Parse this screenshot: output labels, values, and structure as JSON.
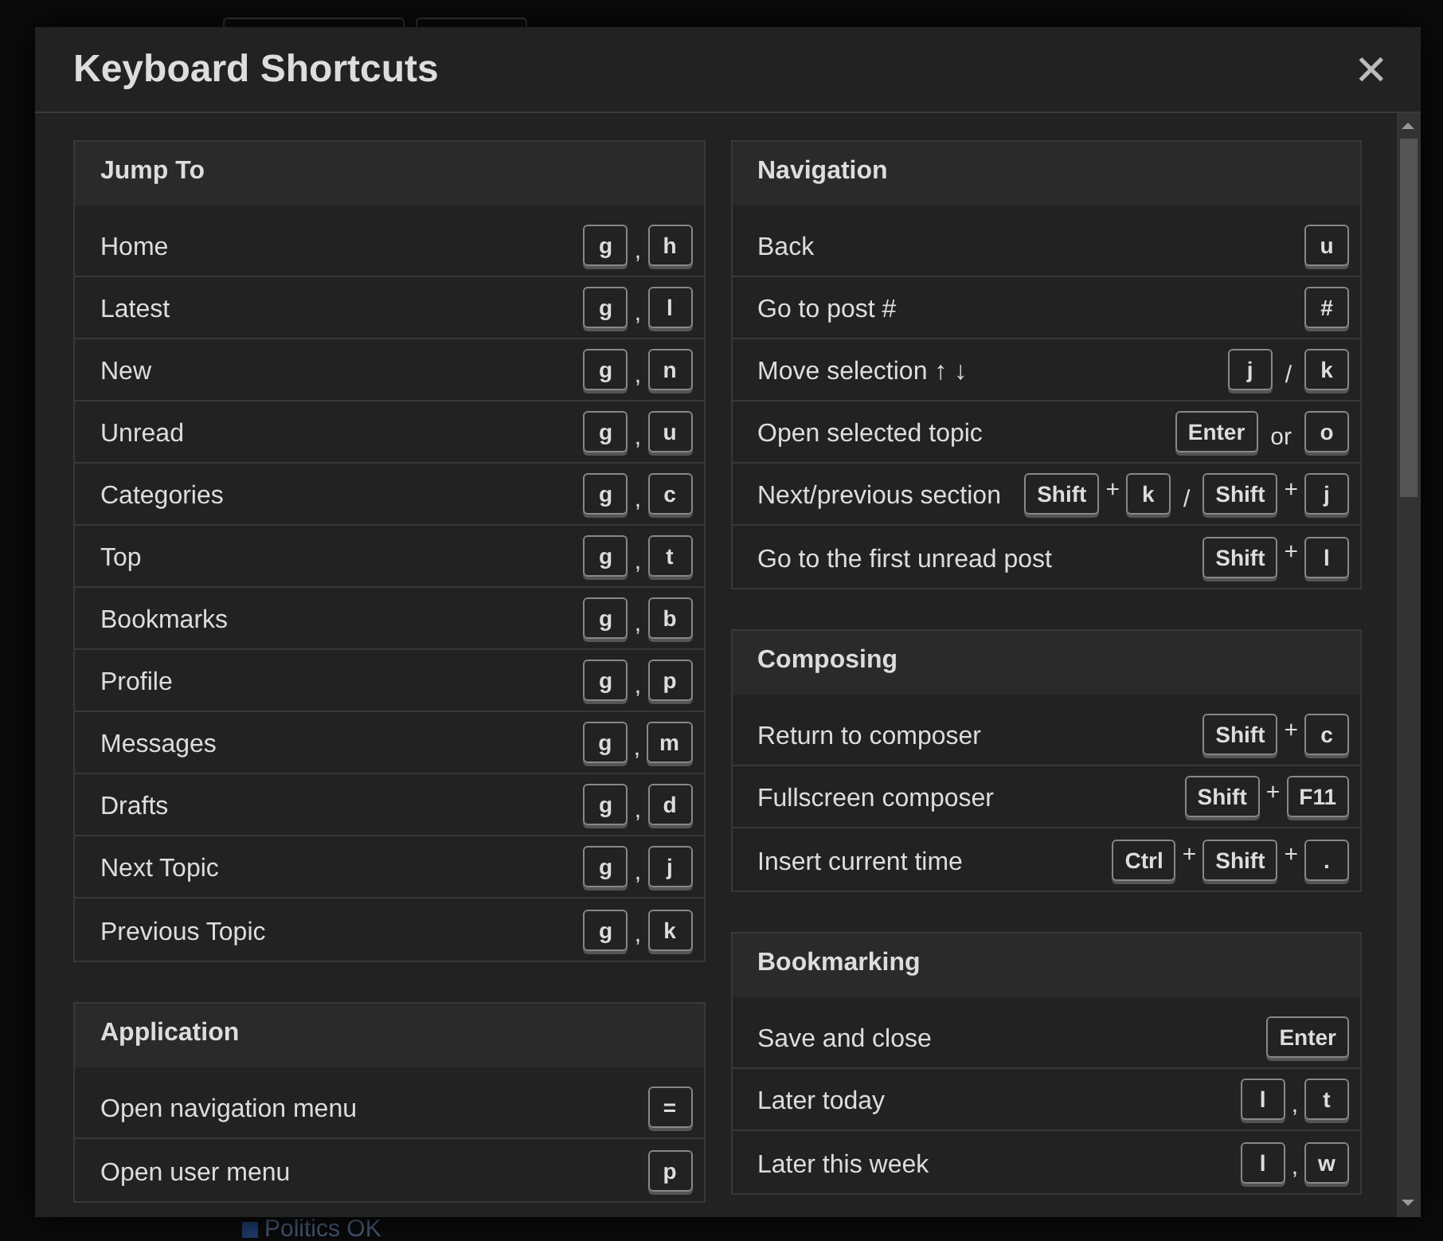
{
  "background": {
    "footer_text": "Politics OK"
  },
  "dialog": {
    "title": "Keyboard Shortcuts",
    "close_symbol": "✕",
    "columns": [
      [
        {
          "title": "Jump To",
          "shortcuts": [
            {
              "label": "Home",
              "keys": [
                {
                  "kind": "key",
                  "text": "g"
                },
                {
                  "kind": "sep",
                  "text": ","
                },
                {
                  "kind": "key",
                  "text": "h"
                }
              ]
            },
            {
              "label": "Latest",
              "keys": [
                {
                  "kind": "key",
                  "text": "g"
                },
                {
                  "kind": "sep",
                  "text": ","
                },
                {
                  "kind": "key",
                  "text": "l"
                }
              ]
            },
            {
              "label": "New",
              "keys": [
                {
                  "kind": "key",
                  "text": "g"
                },
                {
                  "kind": "sep",
                  "text": ","
                },
                {
                  "kind": "key",
                  "text": "n"
                }
              ]
            },
            {
              "label": "Unread",
              "keys": [
                {
                  "kind": "key",
                  "text": "g"
                },
                {
                  "kind": "sep",
                  "text": ","
                },
                {
                  "kind": "key",
                  "text": "u"
                }
              ]
            },
            {
              "label": "Categories",
              "keys": [
                {
                  "kind": "key",
                  "text": "g"
                },
                {
                  "kind": "sep",
                  "text": ","
                },
                {
                  "kind": "key",
                  "text": "c"
                }
              ]
            },
            {
              "label": "Top",
              "keys": [
                {
                  "kind": "key",
                  "text": "g"
                },
                {
                  "kind": "sep",
                  "text": ","
                },
                {
                  "kind": "key",
                  "text": "t"
                }
              ]
            },
            {
              "label": "Bookmarks",
              "keys": [
                {
                  "kind": "key",
                  "text": "g"
                },
                {
                  "kind": "sep",
                  "text": ","
                },
                {
                  "kind": "key",
                  "text": "b"
                }
              ]
            },
            {
              "label": "Profile",
              "keys": [
                {
                  "kind": "key",
                  "text": "g"
                },
                {
                  "kind": "sep",
                  "text": ","
                },
                {
                  "kind": "key",
                  "text": "p"
                }
              ]
            },
            {
              "label": "Messages",
              "keys": [
                {
                  "kind": "key",
                  "text": "g"
                },
                {
                  "kind": "sep",
                  "text": ","
                },
                {
                  "kind": "key",
                  "text": "m"
                }
              ]
            },
            {
              "label": "Drafts",
              "keys": [
                {
                  "kind": "key",
                  "text": "g"
                },
                {
                  "kind": "sep",
                  "text": ","
                },
                {
                  "kind": "key",
                  "text": "d"
                }
              ]
            },
            {
              "label": "Next Topic",
              "keys": [
                {
                  "kind": "key",
                  "text": "g"
                },
                {
                  "kind": "sep",
                  "text": ","
                },
                {
                  "kind": "key",
                  "text": "j"
                }
              ]
            },
            {
              "label": "Previous Topic",
              "keys": [
                {
                  "kind": "key",
                  "text": "g"
                },
                {
                  "kind": "sep",
                  "text": ","
                },
                {
                  "kind": "key",
                  "text": "k"
                }
              ]
            }
          ]
        },
        {
          "title": "Application",
          "shortcuts": [
            {
              "label": "Open navigation menu",
              "keys": [
                {
                  "kind": "key",
                  "text": "="
                }
              ]
            },
            {
              "label": "Open user menu",
              "keys": [
                {
                  "kind": "key",
                  "text": "p"
                }
              ]
            }
          ]
        }
      ],
      [
        {
          "title": "Navigation",
          "shortcuts": [
            {
              "label": "Back",
              "keys": [
                {
                  "kind": "key",
                  "text": "u"
                }
              ]
            },
            {
              "label": "Go to post #",
              "keys": [
                {
                  "kind": "key",
                  "text": "#"
                }
              ]
            },
            {
              "label": "Move selection ↑ ↓",
              "keys": [
                {
                  "kind": "key",
                  "text": "j"
                },
                {
                  "kind": "sep",
                  "text": "/"
                },
                {
                  "kind": "key",
                  "text": "k"
                }
              ]
            },
            {
              "label": "Open selected topic",
              "keys": [
                {
                  "kind": "key",
                  "text": "Enter"
                },
                {
                  "kind": "sep",
                  "text": "or"
                },
                {
                  "kind": "key",
                  "text": "o"
                }
              ]
            },
            {
              "label": "Next/previous section",
              "keys": [
                {
                  "kind": "key",
                  "text": "Shift"
                },
                {
                  "kind": "plus",
                  "text": "+"
                },
                {
                  "kind": "key",
                  "text": "k"
                },
                {
                  "kind": "sep",
                  "text": "/"
                },
                {
                  "kind": "key",
                  "text": "Shift"
                },
                {
                  "kind": "plus",
                  "text": "+"
                },
                {
                  "kind": "key",
                  "text": "j"
                }
              ]
            },
            {
              "label": "Go to the first unread post",
              "keys": [
                {
                  "kind": "key",
                  "text": "Shift"
                },
                {
                  "kind": "plus",
                  "text": "+"
                },
                {
                  "kind": "key",
                  "text": "l"
                }
              ]
            }
          ]
        },
        {
          "title": "Composing",
          "shortcuts": [
            {
              "label": "Return to composer",
              "keys": [
                {
                  "kind": "key",
                  "text": "Shift"
                },
                {
                  "kind": "plus",
                  "text": "+"
                },
                {
                  "kind": "key",
                  "text": "c"
                }
              ]
            },
            {
              "label": "Fullscreen composer",
              "keys": [
                {
                  "kind": "key",
                  "text": "Shift"
                },
                {
                  "kind": "plus",
                  "text": "+"
                },
                {
                  "kind": "key",
                  "text": "F11"
                }
              ]
            },
            {
              "label": "Insert current time",
              "keys": [
                {
                  "kind": "key",
                  "text": "Ctrl"
                },
                {
                  "kind": "plus",
                  "text": "+"
                },
                {
                  "kind": "key",
                  "text": "Shift"
                },
                {
                  "kind": "plus",
                  "text": "+"
                },
                {
                  "kind": "key",
                  "text": "."
                }
              ]
            }
          ]
        },
        {
          "title": "Bookmarking",
          "shortcuts": [
            {
              "label": "Save and close",
              "keys": [
                {
                  "kind": "key",
                  "text": "Enter"
                }
              ]
            },
            {
              "label": "Later today",
              "keys": [
                {
                  "kind": "key",
                  "text": "l"
                },
                {
                  "kind": "sep",
                  "text": ","
                },
                {
                  "kind": "key",
                  "text": "t"
                }
              ]
            },
            {
              "label": "Later this week",
              "keys": [
                {
                  "kind": "key",
                  "text": "l"
                },
                {
                  "kind": "sep",
                  "text": ","
                },
                {
                  "kind": "key",
                  "text": "w"
                }
              ]
            }
          ]
        }
      ]
    ]
  }
}
